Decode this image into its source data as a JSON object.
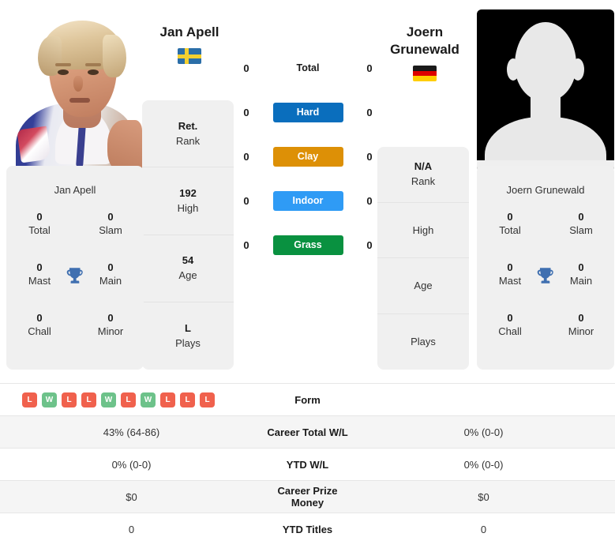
{
  "players": {
    "left": {
      "name": "Jan Apell",
      "flag": "sweden-flag",
      "photo": "player-photo",
      "titles_card": {
        "name": "Jan Apell",
        "trophy_icon": "trophy-icon",
        "stats": [
          {
            "value": "0",
            "label": "Total"
          },
          {
            "value": "0",
            "label": "Slam"
          },
          {
            "value": "0",
            "label": "Mast"
          },
          {
            "value": "0",
            "label": "Main"
          },
          {
            "value": "0",
            "label": "Chall"
          },
          {
            "value": "0",
            "label": "Minor"
          }
        ]
      },
      "rank_card": [
        {
          "value": "Ret.",
          "label": "Rank"
        },
        {
          "value": "192",
          "label": "High"
        },
        {
          "value": "54",
          "label": "Age"
        },
        {
          "value": "L",
          "label": "Plays"
        }
      ]
    },
    "right": {
      "name": "Joern Grunewald",
      "flag": "germany-flag",
      "photo": "player-photo-placeholder",
      "titles_card": {
        "name": "Joern Grunewald",
        "trophy_icon": "trophy-icon",
        "stats": [
          {
            "value": "0",
            "label": "Total"
          },
          {
            "value": "0",
            "label": "Slam"
          },
          {
            "value": "0",
            "label": "Mast"
          },
          {
            "value": "0",
            "label": "Main"
          },
          {
            "value": "0",
            "label": "Chall"
          },
          {
            "value": "0",
            "label": "Minor"
          }
        ]
      },
      "rank_card": [
        {
          "value": "N/A",
          "label": "Rank"
        },
        {
          "value": "",
          "label": "High"
        },
        {
          "value": "",
          "label": "Age"
        },
        {
          "value": "",
          "label": "Plays"
        }
      ]
    }
  },
  "surfaces": [
    {
      "label": "Total",
      "left": "0",
      "right": "0",
      "color": "",
      "style": "plain"
    },
    {
      "label": "Hard",
      "left": "0",
      "right": "0",
      "color": "#0a6ebd",
      "style": "badge"
    },
    {
      "label": "Clay",
      "left": "0",
      "right": "0",
      "color": "#dd9006",
      "style": "badge"
    },
    {
      "label": "Indoor",
      "left": "0",
      "right": "0",
      "color": "#2f9bf5",
      "style": "badge"
    },
    {
      "label": "Grass",
      "left": "0",
      "right": "0",
      "color": "#099140",
      "style": "badge"
    }
  ],
  "stat_rows": [
    {
      "label": "Form",
      "left": "",
      "right": "",
      "type": "form"
    },
    {
      "label": "Career Total W/L",
      "left": "43% (64-86)",
      "right": "0% (0-0)",
      "type": "text"
    },
    {
      "label": "YTD W/L",
      "left": "0% (0-0)",
      "right": "0% (0-0)",
      "type": "text"
    },
    {
      "label": "Career Prize Money",
      "left": "$0",
      "right": "$0",
      "type": "text"
    },
    {
      "label": "YTD Titles",
      "left": "0",
      "right": "0",
      "type": "text"
    }
  ],
  "form": {
    "left": [
      "L",
      "W",
      "L",
      "L",
      "W",
      "L",
      "W",
      "L",
      "L",
      "L"
    ],
    "right": [],
    "win_color": "#6dc28a",
    "loss_color": "#f0614d"
  },
  "colors": {
    "card_bg": "#f0f0f0",
    "row_shade": "#f5f5f5",
    "trophy": "#3f6fb0"
  }
}
